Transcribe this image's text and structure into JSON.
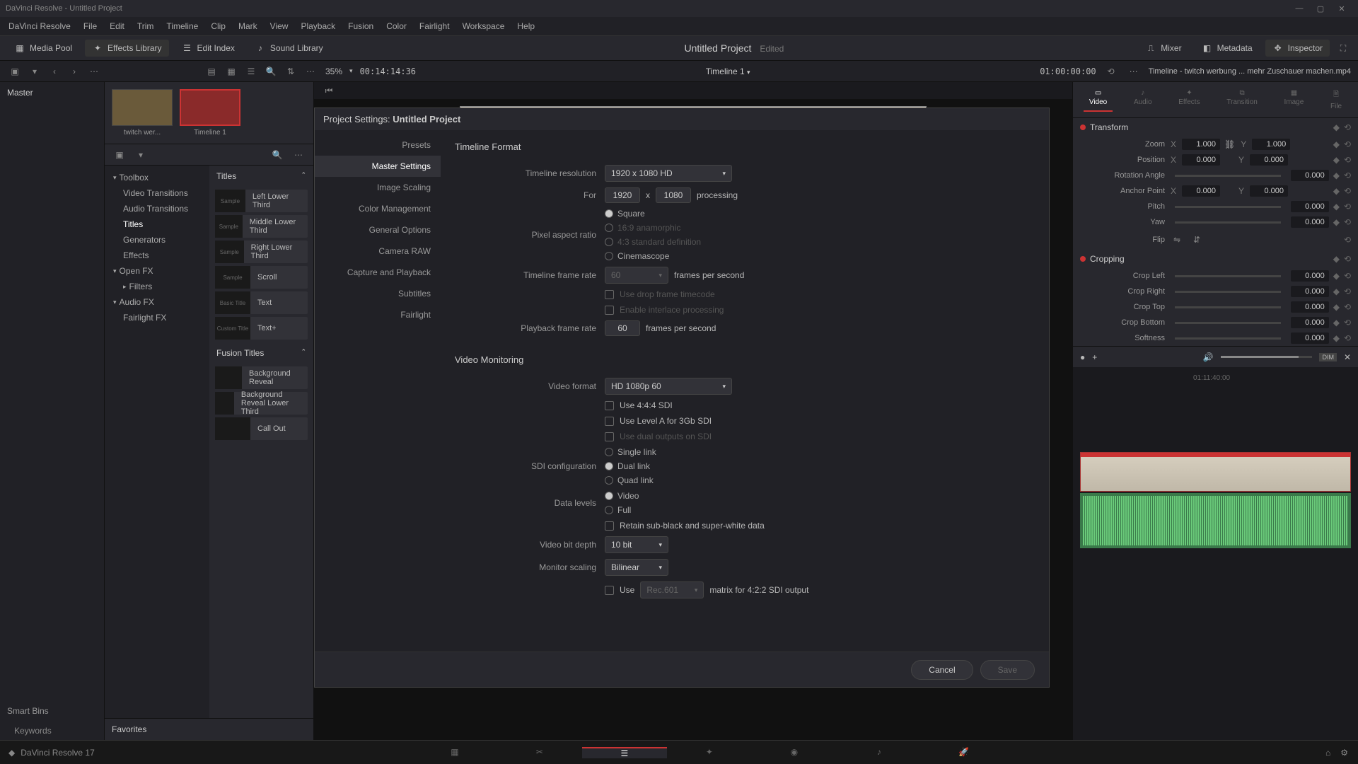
{
  "app": {
    "title": "DaVinci Resolve - Untitled Project",
    "version": "DaVinci Resolve 17"
  },
  "menus": [
    "DaVinci Resolve",
    "File",
    "Edit",
    "Trim",
    "Timeline",
    "Clip",
    "Mark",
    "View",
    "Playback",
    "Fusion",
    "Color",
    "Fairlight",
    "Workspace",
    "Help"
  ],
  "toolbar": {
    "media_pool": "Media Pool",
    "effects_library": "Effects Library",
    "edit_index": "Edit Index",
    "sound_library": "Sound Library",
    "project_title": "Untitled Project",
    "edited": "Edited",
    "mixer": "Mixer",
    "metadata": "Metadata",
    "inspector": "Inspector"
  },
  "subbar": {
    "zoom": "35%",
    "timecode_left": "00:14:14:36",
    "timeline_name": "Timeline 1",
    "timecode_right": "01:00:00:00",
    "inspector_title": "Timeline - twitch werbung ... mehr Zuschauer machen.mp4"
  },
  "bins": {
    "master": "Master",
    "thumbs": [
      {
        "label": "twitch wer..."
      },
      {
        "label": "Timeline 1"
      }
    ],
    "smart_bins": "Smart Bins",
    "keywords": "Keywords"
  },
  "fx": {
    "tree": [
      {
        "label": "Toolbox",
        "expand": true
      },
      {
        "label": "Video Transitions",
        "sub": true
      },
      {
        "label": "Audio Transitions",
        "sub": true
      },
      {
        "label": "Titles",
        "sub": true,
        "selected": true
      },
      {
        "label": "Generators",
        "sub": true
      },
      {
        "label": "Effects",
        "sub": true
      },
      {
        "label": "Open FX",
        "expand": true
      },
      {
        "label": "Filters",
        "sub": true
      },
      {
        "label": "Audio FX",
        "expand": true
      },
      {
        "label": "Fairlight FX",
        "sub": true
      }
    ],
    "titles_hdr": "Titles",
    "titles": [
      "Left Lower Third",
      "Middle Lower Third",
      "Right Lower Third",
      "Scroll",
      "Text",
      "Text+"
    ],
    "fusion_hdr": "Fusion Titles",
    "fusion": [
      "Background Reveal",
      "Background Reveal Lower Third",
      "Call Out"
    ],
    "favorites": "Favorites"
  },
  "modal": {
    "title_prefix": "Project Settings:",
    "title_project": "Untitled Project",
    "nav": [
      "Presets",
      "Master Settings",
      "Image Scaling",
      "Color Management",
      "General Options",
      "Camera RAW",
      "Capture and Playback",
      "Subtitles",
      "Fairlight"
    ],
    "nav_active": "Master Settings",
    "timeline_format": {
      "hdr": "Timeline Format",
      "resolution_lbl": "Timeline resolution",
      "resolution_val": "1920 x 1080 HD",
      "for": "For",
      "w": "1920",
      "x": "x",
      "h": "1080",
      "processing": "processing",
      "par_lbl": "Pixel aspect ratio",
      "par_opts": [
        "Square",
        "16:9 anamorphic",
        "4:3 standard definition",
        "Cinemascope"
      ],
      "tfr_lbl": "Timeline frame rate",
      "tfr_val": "60",
      "fps": "frames per second",
      "drop": "Use drop frame timecode",
      "interlace": "Enable interlace processing",
      "pfr_lbl": "Playback frame rate",
      "pfr_val": "60"
    },
    "video_monitoring": {
      "hdr": "Video Monitoring",
      "format_lbl": "Video format",
      "format_val": "HD 1080p 60",
      "use444": "Use 4:4:4 SDI",
      "levela": "Use Level A for 3Gb SDI",
      "dual_out": "Use dual outputs on SDI",
      "sdi_lbl": "SDI configuration",
      "sdi_opts": [
        "Single link",
        "Dual link",
        "Quad link"
      ],
      "levels_lbl": "Data levels",
      "levels_opts": [
        "Video",
        "Full"
      ],
      "retain": "Retain sub-black and super-white data",
      "bitdepth_lbl": "Video bit depth",
      "bitdepth_val": "10 bit",
      "scaling_lbl": "Monitor scaling",
      "scaling_val": "Bilinear",
      "use": "Use",
      "matrix_val": "Rec.601",
      "matrix_suffix": "matrix for 4:2:2 SDI output"
    },
    "cancel": "Cancel",
    "save": "Save"
  },
  "inspector": {
    "tabs": [
      "Video",
      "Audio",
      "Effects",
      "Transition",
      "Image",
      "File"
    ],
    "transform": {
      "hdr": "Transform",
      "zoom": "Zoom",
      "zoom_x": "1.000",
      "zoom_y": "1.000",
      "position": "Position",
      "pos_x": "0.000",
      "pos_y": "0.000",
      "rotation": "Rotation Angle",
      "rot_v": "0.000",
      "anchor": "Anchor Point",
      "anc_x": "0.000",
      "anc_y": "0.000",
      "pitch": "Pitch",
      "pitch_v": "0.000",
      "yaw": "Yaw",
      "yaw_v": "0.000",
      "flip": "Flip"
    },
    "cropping": {
      "hdr": "Cropping",
      "left": "Crop Left",
      "left_v": "0.000",
      "right": "Crop Right",
      "right_v": "0.000",
      "top": "Crop Top",
      "top_v": "0.000",
      "bottom": "Crop Bottom",
      "bottom_v": "0.000",
      "softness": "Softness",
      "soft_v": "0.000"
    },
    "dim": "DIM",
    "ruler_time": "01:11:40:00"
  }
}
